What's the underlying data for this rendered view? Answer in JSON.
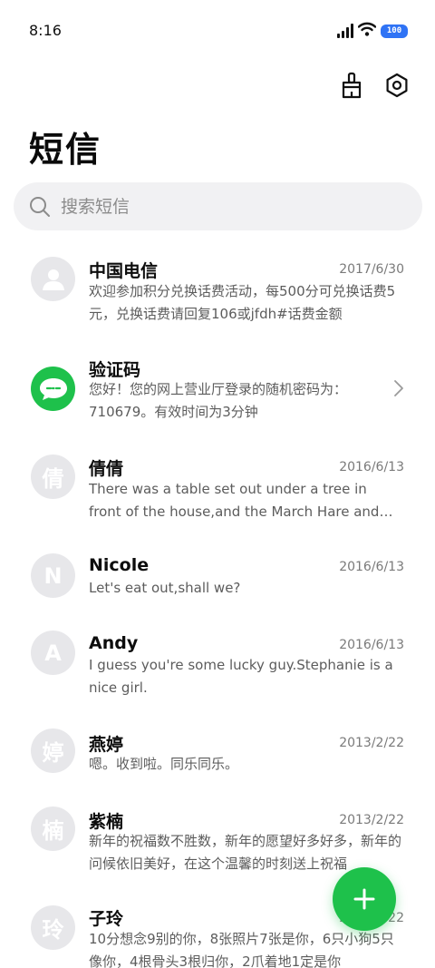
{
  "status_bar": {
    "time": "8:16",
    "battery": "100"
  },
  "header": {
    "title": "短信",
    "clean_icon": "broom-icon",
    "settings_icon": "gear-icon"
  },
  "search": {
    "placeholder": "搜索短信"
  },
  "messages": [
    {
      "name": "中国电信",
      "date": "2017/6/30",
      "avatar": "",
      "avatar_type": "person",
      "preview": "欢迎参加积分兑换话费活动，每500分可兑换话费5元，兑换话费请回复106或jfdh#话费金额"
    },
    {
      "name": "验证码",
      "date": "",
      "avatar": "",
      "avatar_type": "chat",
      "preview": "您好！您的网上营业厅登录的随机密码为：710679。有效时间为3分钟"
    },
    {
      "name": "倩倩",
      "date": "2016/6/13",
      "avatar": "倩",
      "avatar_type": "letter",
      "preview": "There was a table set out under a tree in front of the house,and the March Hare and the Hatter were having tea"
    },
    {
      "name": "Nicole",
      "date": "2016/6/13",
      "avatar": "N",
      "avatar_type": "letter",
      "preview": "Let's eat out,shall we?"
    },
    {
      "name": "Andy",
      "date": "2016/6/13",
      "avatar": "A",
      "avatar_type": "letter",
      "preview": "I guess you're some lucky guy.Stephanie is a nice girl."
    },
    {
      "name": "燕婷",
      "date": "2013/2/22",
      "avatar": "婷",
      "avatar_type": "letter",
      "preview": "嗯。收到啦。同乐同乐。"
    },
    {
      "name": "紫楠",
      "date": "2013/2/22",
      "avatar": "楠",
      "avatar_type": "letter",
      "preview": "新年的祝福数不胜数，新年的愿望好多好多，新年的问候依旧美好，在这个温馨的时刻送上祝福"
    },
    {
      "name": "子玲",
      "date": "2013/2/22",
      "avatar": "玲",
      "avatar_type": "letter",
      "preview": "10分想念9别的你，8张照片7张是你，6只小狗5只像你，4根骨头3根归你，2爪着地1定是你"
    }
  ],
  "fab": {
    "icon": "plus-icon"
  },
  "colors": {
    "accent": "#1ec14b",
    "battery": "#2f73f5",
    "avatar_bg": "#e7e7ea"
  }
}
